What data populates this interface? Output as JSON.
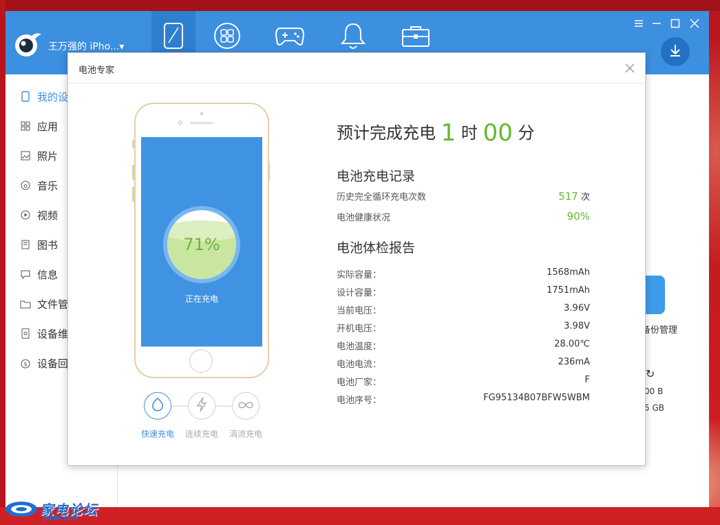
{
  "app": {
    "device_name": "王万强的 iPho...▾",
    "nav_tabs": [
      "my-device",
      "apps",
      "games",
      "ringtones",
      "toolbox"
    ],
    "background": {
      "backup_label": "备份管理",
      "size_used": "00 B",
      "size_total": "5 GB"
    }
  },
  "sidebar": {
    "items": [
      {
        "label": "我的设",
        "icon": "phone-icon",
        "active": true
      },
      {
        "label": "应用",
        "icon": "apps-grid-icon"
      },
      {
        "label": "照片",
        "icon": "photo-icon"
      },
      {
        "label": "音乐",
        "icon": "music-icon"
      },
      {
        "label": "视频",
        "icon": "video-icon"
      },
      {
        "label": "图书",
        "icon": "book-icon"
      },
      {
        "label": "信息",
        "icon": "message-icon"
      },
      {
        "label": "文件管",
        "icon": "folder-icon"
      },
      {
        "label": "设备维",
        "icon": "maintenance-icon"
      },
      {
        "label": "设备回",
        "icon": "recycle-icon"
      }
    ]
  },
  "dialog": {
    "title": "电池专家",
    "battery_percent": "71%",
    "battery_level": 0.71,
    "charging_status": "正在充电",
    "modes": [
      {
        "label": "快速充电",
        "active": true
      },
      {
        "label": "连续充电",
        "active": false
      },
      {
        "label": "涓流充电",
        "active": false
      }
    ],
    "eta": {
      "prefix": "预计完成充电",
      "hours": "1",
      "hour_unit": "时",
      "minutes": "00",
      "minute_unit": "分"
    },
    "charge_record": {
      "title": "电池充电记录",
      "cycles_label": "历史完全循环充电次数",
      "cycles_value": "517",
      "cycles_unit": "次",
      "health_label": "电池健康状况",
      "health_value": "90%"
    },
    "report": {
      "title": "电池体检报告",
      "rows": [
        {
          "label": "实际容量：",
          "value": "1568mAh"
        },
        {
          "label": "设计容量：",
          "value": "1751mAh"
        },
        {
          "label": "当前电压：",
          "value": "3.96V"
        },
        {
          "label": "开机电压：",
          "value": "3.98V"
        },
        {
          "label": "电池温度：",
          "value": "28.00℃"
        },
        {
          "label": "电池电流：",
          "value": "236mA"
        },
        {
          "label": "电池厂家：",
          "value": "F"
        },
        {
          "label": "电池序号：",
          "value": "FG95134B07BFW5WBM"
        }
      ]
    }
  },
  "watermark": {
    "text": "家电论坛",
    "sub": "JDBBS.COM"
  },
  "colors": {
    "accent": "#3d8fe0",
    "green": "#62b82b",
    "battery_fill": "#c9e6a0"
  }
}
